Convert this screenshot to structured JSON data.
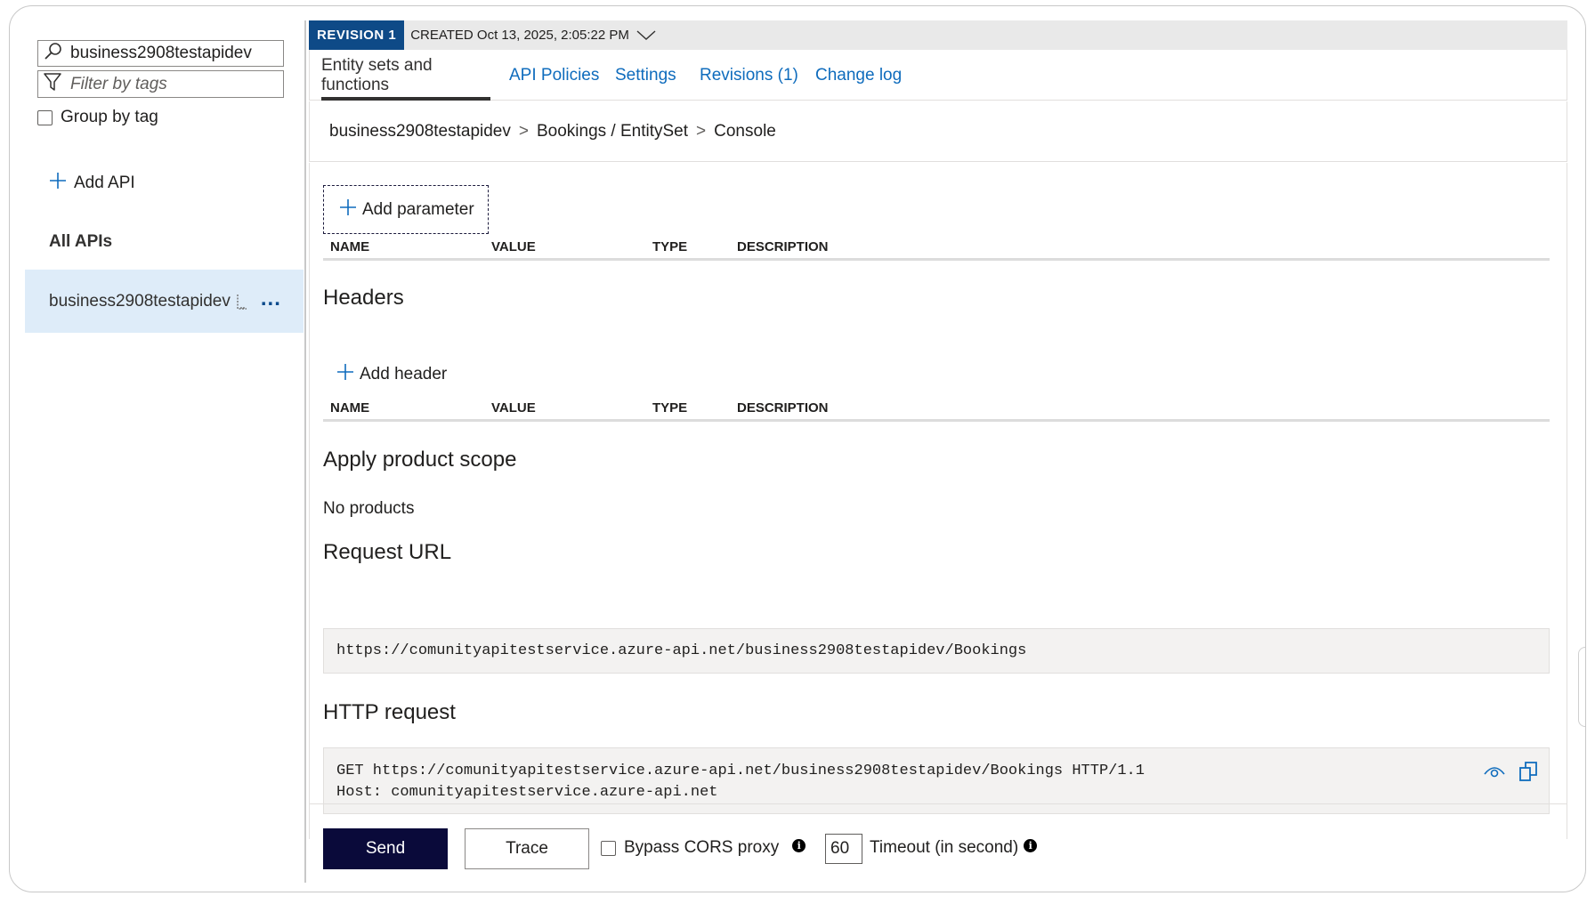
{
  "sidebar": {
    "search_value": "business2908testapidev",
    "filter_placeholder": "Filter by tags",
    "group_by_label": "Group by tag",
    "add_api_label": "Add API",
    "all_apis_label": "All APIs",
    "api_item_label": "business2908testapidev",
    "more_label": "..."
  },
  "revision": {
    "badge": "REVISION 1",
    "created": "CREATED Oct 13, 2025, 2:05:22 PM"
  },
  "tabs": [
    {
      "label": "Entity sets and functions"
    },
    {
      "label": "API Policies"
    },
    {
      "label": "Settings"
    },
    {
      "label": "Revisions (1)"
    },
    {
      "label": "Change log"
    }
  ],
  "breadcrumb": [
    "business2908testapidev",
    "Bookings / EntitySet",
    "Console"
  ],
  "breadcrumb_sep": ">",
  "params": {
    "add_label": "Add parameter",
    "columns": [
      "NAME",
      "VALUE",
      "TYPE",
      "DESCRIPTION"
    ]
  },
  "headers": {
    "title": "Headers",
    "add_label": "Add header",
    "columns": [
      "NAME",
      "VALUE",
      "TYPE",
      "DESCRIPTION"
    ]
  },
  "product_scope": {
    "title": "Apply product scope",
    "value": "No products"
  },
  "request_url": {
    "title": "Request URL",
    "value": "https://comunityapitestservice.azure-api.net/business2908testapidev/Bookings"
  },
  "http_request": {
    "title": "HTTP request",
    "line1": "GET https://comunityapitestservice.azure-api.net/business2908testapidev/Bookings HTTP/1.1",
    "line2": "Host: comunityapitestservice.azure-api.net"
  },
  "footer": {
    "send_label": "Send",
    "trace_label": "Trace",
    "bypass_label": "Bypass CORS proxy",
    "timeout_value": "60",
    "timeout_label": "Timeout (in second)",
    "info_glyph": "i"
  },
  "colors": {
    "accent": "#0f6cbd",
    "revision_badge": "#0e4a87",
    "send_button": "#0a0a3a",
    "selected_item": "#deecf9"
  }
}
